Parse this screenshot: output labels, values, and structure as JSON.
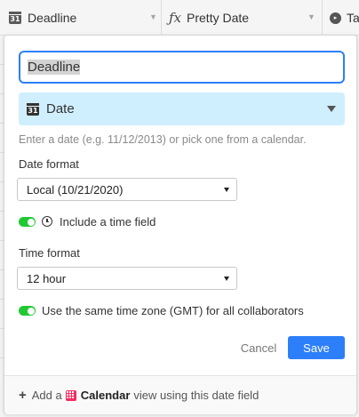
{
  "header": {
    "columns": [
      {
        "name": "Deadline",
        "icon": "calendar-icon"
      },
      {
        "name": "Pretty Date",
        "icon": "formula-icon"
      },
      {
        "name": "Ta",
        "icon": "tag-icon"
      }
    ]
  },
  "field": {
    "name_value": "Deadline",
    "type_label": "Date",
    "type_icon": "calendar-icon",
    "help_text": "Enter a date (e.g. 11/12/2013) or pick one from a calendar.",
    "date_format_label": "Date format",
    "date_format_value": "Local (10/21/2020)",
    "include_time_label": "Include a time field",
    "time_format_label": "Time format",
    "time_format_value": "12 hour",
    "timezone_label": "Use the same time zone (GMT) for all collaborators"
  },
  "actions": {
    "cancel_label": "Cancel",
    "save_label": "Save"
  },
  "footer": {
    "prefix": "Add a",
    "view_name": "Calendar",
    "suffix": "view using this date field"
  },
  "colors": {
    "accent": "#2d7ff9",
    "type_select_bg": "#cfefff",
    "toggle_on": "#20c933",
    "calendar_view": "#f82b60"
  }
}
